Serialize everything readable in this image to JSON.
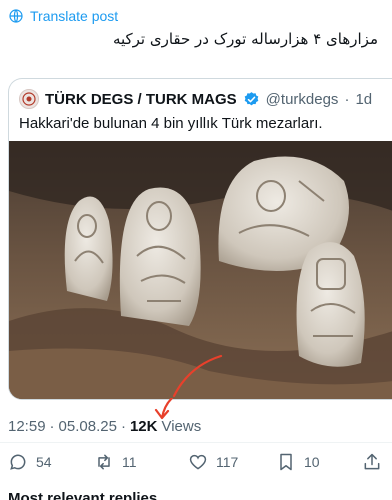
{
  "translate": {
    "label": "Translate post",
    "icon": "globe-icon"
  },
  "post": {
    "text": "مزارهای ۴ هزارساله تورک در حقاری ترکیه"
  },
  "quoted": {
    "name": "TÜRK DEGS / TURK MAGS",
    "handle": "@turkdegs",
    "separator": "·",
    "age": "1d",
    "text": "Hakkari'de bulunan 4 bin yıllık Türk mezarları."
  },
  "meta": {
    "time": "12:59",
    "separator": "·",
    "date": "05.08.25",
    "separator2": "·",
    "views_count": "12K",
    "views_label": "Views"
  },
  "actions": {
    "replies": "54",
    "reposts": "11",
    "likes": "117",
    "bookmarks": "10"
  },
  "more": {
    "label": "Most relevant replies"
  },
  "colors": {
    "accent": "#1d9bf0",
    "arrow": "#e8402b",
    "muted": "#536471"
  }
}
